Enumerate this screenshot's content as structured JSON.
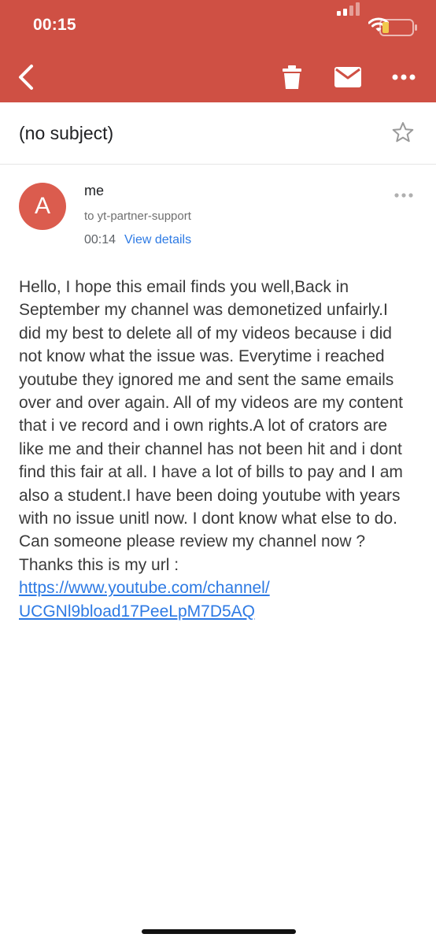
{
  "status_bar": {
    "time": "00:15",
    "icons": [
      "signal-icon",
      "wifi-icon",
      "battery-icon"
    ]
  },
  "toolbar": {
    "background_color": "#cf5044",
    "icons": [
      "back-arrow-icon",
      "trash-icon",
      "mail-icon",
      "more-horizontal-icon"
    ]
  },
  "subject": {
    "text": "(no subject)",
    "icon": "star-outline-icon"
  },
  "message": {
    "avatar_letter": "A",
    "avatar_color": "#db5c4e",
    "sender": "me",
    "recipient": "to yt-partner-support",
    "time": "00:14",
    "view_details_label": "View details",
    "body": "Hello, I hope this email finds you well,Back in September my channel was demonetized unfairly.I did my best to delete all of my videos because i did not know what the issue was. Everytime i reached youtube they ignored me and sent the same emails over and over again. All of my videos are my content that i ve record and i own rights.A lot of crators are like me and their channel has not been hit and i dont find this fair at all. I have a lot of bills to pay and I am also a student.I have been doing youtube with years with no issue unitl now. I dont know what else to do. Can someone please review my channel now ? Thanks this is my url :",
    "link_line1": "https://www.youtube.com/channel/",
    "link_line2": "UCGNl9bload17PeeLpM7D5AQ"
  },
  "colors": {
    "link": "#2d7ae4",
    "accent": "#cf5044"
  }
}
